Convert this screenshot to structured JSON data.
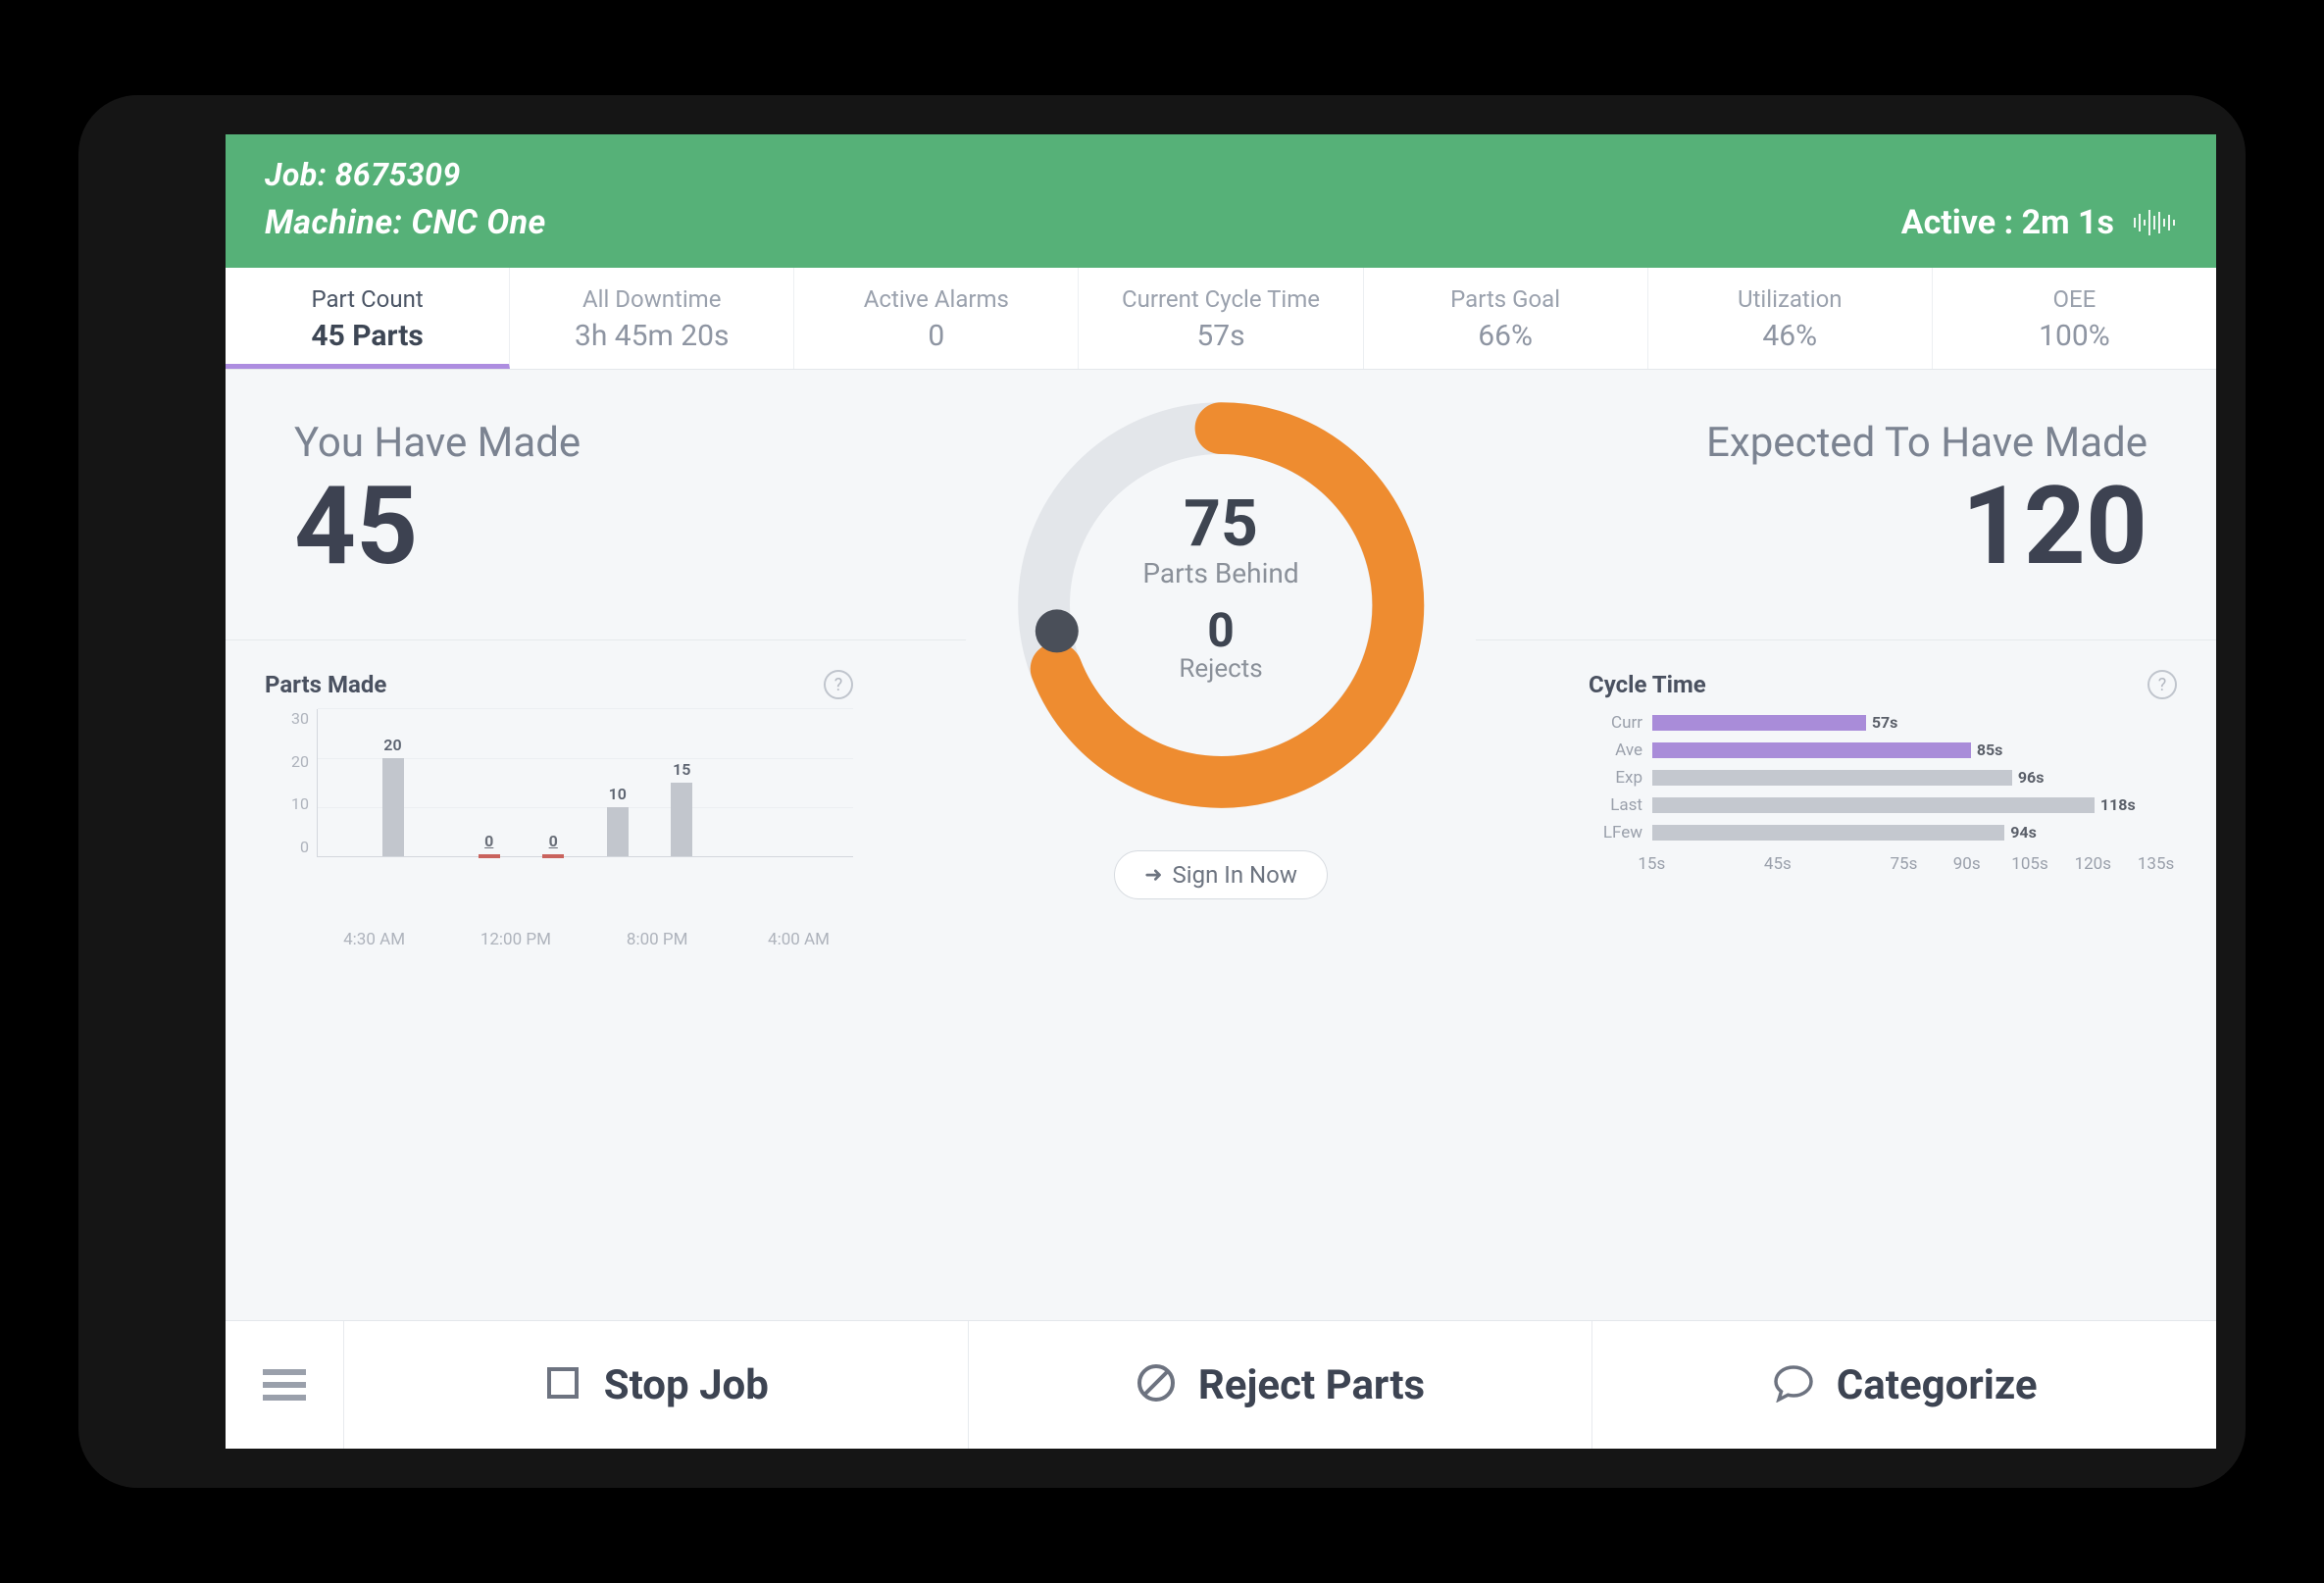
{
  "header": {
    "job_label": "Job: 8675309",
    "machine_label": "Machine: CNC One",
    "active_label": "Active : 2m 1s"
  },
  "tabs": [
    {
      "label": "Part Count",
      "value": "45 Parts",
      "active": true
    },
    {
      "label": "All Downtime",
      "value": "3h 45m 20s",
      "active": false
    },
    {
      "label": "Active Alarms",
      "value": "0",
      "active": false
    },
    {
      "label": "Current Cycle Time",
      "value": "57s",
      "active": false
    },
    {
      "label": "Parts Goal",
      "value": "66%",
      "active": false
    },
    {
      "label": "Utilization",
      "value": "46%",
      "active": false
    },
    {
      "label": "OEE",
      "value": "100%",
      "active": false
    }
  ],
  "counts": {
    "made_label": "You Have Made",
    "made_value": "45",
    "expected_label": "Expected To Have Made",
    "expected_value": "120"
  },
  "gauge": {
    "behind_value": "75",
    "behind_label": "Parts Behind",
    "rejects_value": "0",
    "rejects_label": "Rejects",
    "signin_label": "Sign In Now"
  },
  "parts_made_chart": {
    "title": "Parts Made"
  },
  "cycle_time_chart": {
    "title": "Cycle Time"
  },
  "footer": {
    "stop": "Stop Job",
    "reject": "Reject Parts",
    "categorize": "Categorize"
  },
  "chart_data": [
    {
      "type": "bar",
      "title": "Parts Made",
      "ylim": [
        0,
        30
      ],
      "yticks": [
        0,
        10,
        20,
        30
      ],
      "categories": [
        "4:30 AM",
        "12:00 PM",
        "8:00 PM",
        "4:00 AM"
      ],
      "bars": [
        {
          "x": 12,
          "value": 20
        },
        {
          "x": 30,
          "value": 0
        },
        {
          "x": 42,
          "value": 0
        },
        {
          "x": 54,
          "value": 10
        },
        {
          "x": 66,
          "value": 15
        }
      ]
    },
    {
      "type": "bar",
      "orientation": "horizontal",
      "title": "Cycle Time",
      "xlim": [
        0,
        140
      ],
      "xticks": [
        "15s",
        "45s",
        "75s",
        "90s",
        "105s",
        "120s",
        "135s"
      ],
      "series": [
        {
          "name": "Curr",
          "value": 57,
          "color": "purple"
        },
        {
          "name": "Ave",
          "value": 85,
          "color": "purple"
        },
        {
          "name": "Exp",
          "value": 96,
          "color": "grey"
        },
        {
          "name": "Last",
          "value": 118,
          "color": "grey"
        },
        {
          "name": "LFew",
          "value": 94,
          "color": "grey"
        }
      ]
    }
  ]
}
